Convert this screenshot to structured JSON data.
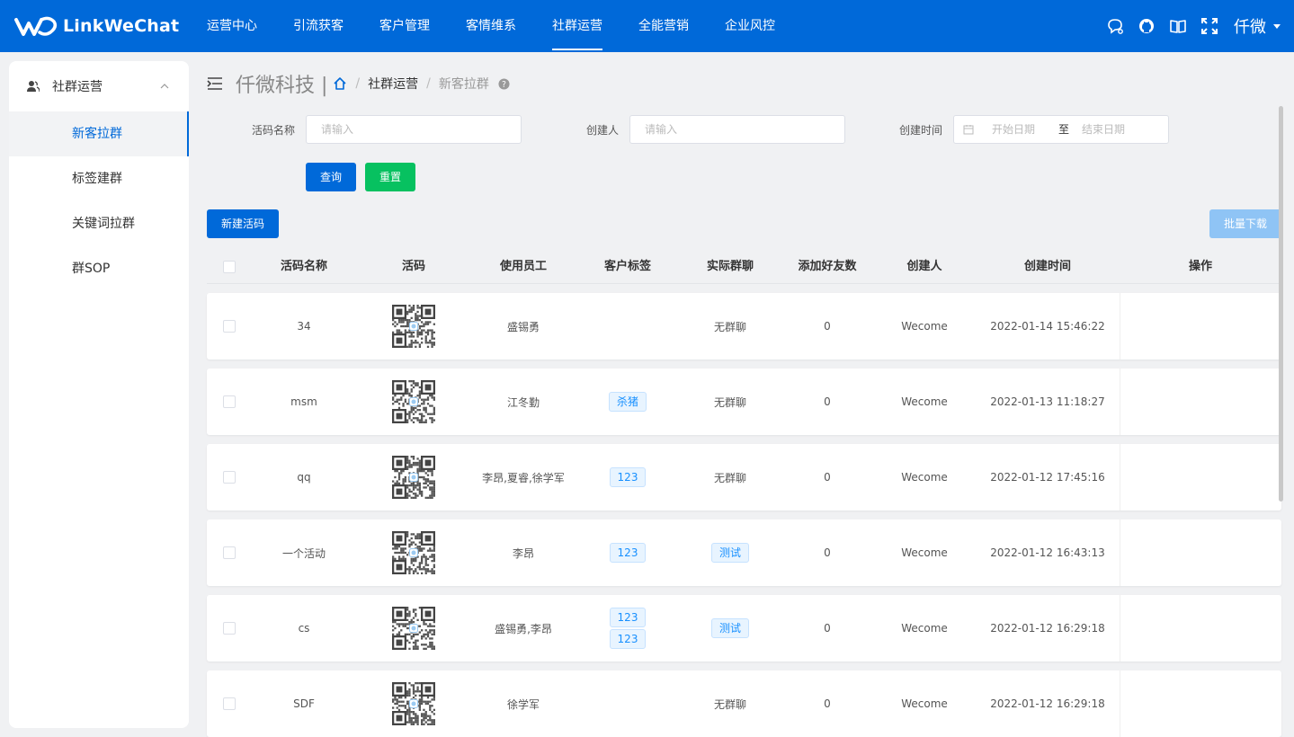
{
  "brand": {
    "name": "LinkWeChat"
  },
  "nav": {
    "items": [
      {
        "label": "运营中心"
      },
      {
        "label": "引流获客"
      },
      {
        "label": "客户管理"
      },
      {
        "label": "客情维系"
      },
      {
        "label": "社群运营"
      },
      {
        "label": "全能营销"
      },
      {
        "label": "企业风控"
      }
    ],
    "active_index": 4
  },
  "user": {
    "name": "仟微"
  },
  "icons": [
    "chat-bubble-icon",
    "github-icon",
    "book-icon",
    "fullscreen-icon",
    "chevron-down-icon"
  ],
  "sidebar": {
    "group_label": "社群运营",
    "items": [
      {
        "label": "新客拉群"
      },
      {
        "label": "标签建群"
      },
      {
        "label": "关键词拉群"
      },
      {
        "label": "群SOP"
      }
    ],
    "active_index": 0
  },
  "header": {
    "company": "仟微科技 |",
    "crumbs": [
      "社群运营",
      "新客拉群"
    ]
  },
  "filters": {
    "name_label": "活码名称",
    "name_placeholder": "请输入",
    "creator_label": "创建人",
    "creator_placeholder": "请输入",
    "time_label": "创建时间",
    "start_placeholder": "开始日期",
    "range_sep": "至",
    "end_placeholder": "结束日期",
    "query_button": "查询",
    "reset_button": "重置"
  },
  "actions": {
    "new_button": "新建活码",
    "batch_download_button": "批量下载"
  },
  "colors": {
    "primary": "#0069d9",
    "success": "#07c160",
    "disabled_blue": "#8fc4f5"
  },
  "table": {
    "headers": [
      "活码名称",
      "活码",
      "使用员工",
      "客户标签",
      "实际群聊",
      "添加好友数",
      "创建人",
      "创建时间",
      "操作"
    ],
    "rows": [
      {
        "name": "34",
        "staff": "盛锡勇",
        "tags": [],
        "group": "无群聊",
        "group_tag": false,
        "friends": "0",
        "creator": "Wecome",
        "time": "2022-01-14 15:46:22"
      },
      {
        "name": "msm",
        "staff": "江冬勤",
        "tags": [
          "杀猪"
        ],
        "group": "无群聊",
        "group_tag": false,
        "friends": "0",
        "creator": "Wecome",
        "time": "2022-01-13 11:18:27"
      },
      {
        "name": "qq",
        "staff": "李昂,夏睿,徐学军",
        "tags": [
          "123"
        ],
        "group": "无群聊",
        "group_tag": false,
        "friends": "0",
        "creator": "Wecome",
        "time": "2022-01-12 17:45:16"
      },
      {
        "name": "一个活动",
        "staff": "李昂",
        "tags": [
          "123"
        ],
        "group": "测试",
        "group_tag": true,
        "friends": "0",
        "creator": "Wecome",
        "time": "2022-01-12 16:43:13"
      },
      {
        "name": "cs",
        "staff": "盛锡勇,李昂",
        "tags": [
          "123",
          "123"
        ],
        "group": "测试",
        "group_tag": true,
        "friends": "0",
        "creator": "Wecome",
        "time": "2022-01-12 16:29:18"
      },
      {
        "name": "SDF",
        "staff": "徐学军",
        "tags": [],
        "group": "无群聊",
        "group_tag": false,
        "friends": "0",
        "creator": "Wecome",
        "time": "2022-01-12 16:29:18"
      }
    ]
  }
}
